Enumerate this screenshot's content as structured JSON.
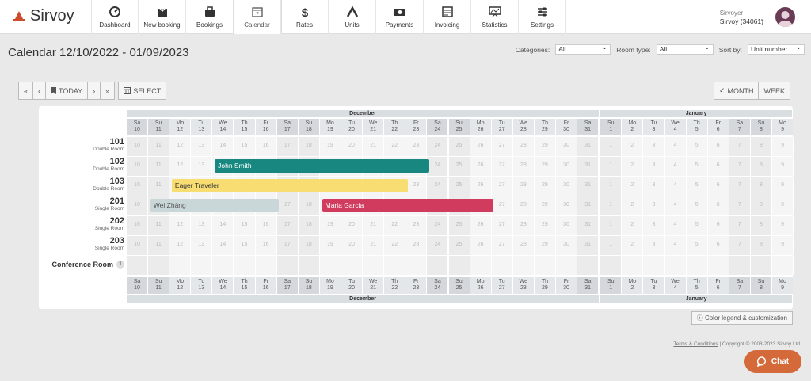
{
  "brand": {
    "name": "Sirvoy",
    "color": "#cc4b2b"
  },
  "nav": [
    {
      "label": "Dashboard",
      "icon": "dashboard-icon"
    },
    {
      "label": "New booking",
      "icon": "new-booking-icon"
    },
    {
      "label": "Bookings",
      "icon": "bookings-icon"
    },
    {
      "label": "Calendar",
      "icon": "calendar-icon",
      "active": true
    },
    {
      "label": "Rates",
      "icon": "dollar-icon"
    },
    {
      "label": "Units",
      "icon": "units-icon"
    },
    {
      "label": "Payments",
      "icon": "payments-icon"
    },
    {
      "label": "Invoicing",
      "icon": "invoicing-icon"
    },
    {
      "label": "Statistics",
      "icon": "statistics-icon"
    },
    {
      "label": "Settings",
      "icon": "settings-icon"
    }
  ],
  "user": {
    "name": "Sirvoyer",
    "account": "Sirvoy (34061)"
  },
  "page": {
    "title": "Calendar 12/10/2022 - 01/09/2023"
  },
  "filters": {
    "categories_label": "Categories:",
    "categories_value": "All",
    "roomtype_label": "Room type:",
    "roomtype_value": "All",
    "sortby_label": "Sort by:",
    "sortby_value": "Unit number"
  },
  "toolbar": {
    "first": "«",
    "prev": "‹",
    "today": "TODAY",
    "next": "›",
    "last": "»",
    "select": "SELECT",
    "month": "MONTH",
    "week": "WEEK"
  },
  "calendar": {
    "months": [
      {
        "name": "December"
      },
      {
        "name": "January"
      }
    ],
    "days": [
      {
        "dow": "Sa",
        "d": "10",
        "we": true
      },
      {
        "dow": "Su",
        "d": "11",
        "we": true
      },
      {
        "dow": "Mo",
        "d": "12"
      },
      {
        "dow": "Tu",
        "d": "13"
      },
      {
        "dow": "We",
        "d": "14"
      },
      {
        "dow": "Th",
        "d": "15"
      },
      {
        "dow": "Fr",
        "d": "16"
      },
      {
        "dow": "Sa",
        "d": "17",
        "we": true
      },
      {
        "dow": "Su",
        "d": "18",
        "we": true
      },
      {
        "dow": "Mo",
        "d": "19"
      },
      {
        "dow": "Tu",
        "d": "20"
      },
      {
        "dow": "We",
        "d": "21"
      },
      {
        "dow": "Th",
        "d": "22"
      },
      {
        "dow": "Fr",
        "d": "23"
      },
      {
        "dow": "Sa",
        "d": "24",
        "we": true
      },
      {
        "dow": "Su",
        "d": "25",
        "we": true
      },
      {
        "dow": "Mo",
        "d": "26"
      },
      {
        "dow": "Tu",
        "d": "27"
      },
      {
        "dow": "We",
        "d": "28"
      },
      {
        "dow": "Th",
        "d": "29"
      },
      {
        "dow": "Fr",
        "d": "30"
      },
      {
        "dow": "Sa",
        "d": "31",
        "we": true
      },
      {
        "dow": "Su",
        "d": "1",
        "we": true
      },
      {
        "dow": "Mo",
        "d": "2"
      },
      {
        "dow": "Tu",
        "d": "3"
      },
      {
        "dow": "We",
        "d": "4"
      },
      {
        "dow": "Th",
        "d": "5"
      },
      {
        "dow": "Fr",
        "d": "6"
      },
      {
        "dow": "Sa",
        "d": "7",
        "we": true
      },
      {
        "dow": "Su",
        "d": "8",
        "we": true
      },
      {
        "dow": "Mo",
        "d": "9"
      }
    ],
    "rooms": [
      {
        "number": "101",
        "type": "Double Room"
      },
      {
        "number": "102",
        "type": "Double Room"
      },
      {
        "number": "103",
        "type": "Double Room"
      },
      {
        "number": "201",
        "type": "Single Room"
      },
      {
        "number": "202",
        "type": "Single Room"
      },
      {
        "number": "203",
        "type": "Single Room"
      },
      {
        "number": "Conference Room",
        "type": "",
        "badge": "1"
      }
    ],
    "bookings": [
      {
        "guest": "John Smith",
        "room_index": 1,
        "start_day": "14",
        "end_day": "24",
        "color": "#17877f",
        "text_color": "#ffffff"
      },
      {
        "guest": "Eager Traveler",
        "room_index": 2,
        "start_day": "12",
        "end_day": "23",
        "color": "#f7dd72",
        "text_color": "#333333"
      },
      {
        "guest": "Wei Zhāng",
        "room_index": 3,
        "start_day": "11",
        "end_day": "17",
        "color": "#c9d7d9",
        "text_color": "#555555"
      },
      {
        "guest": "Maria Garcia",
        "room_index": 3,
        "start_day": "19",
        "end_day": "27",
        "color": "#d13b5e",
        "text_color": "#ffffff"
      }
    ]
  },
  "legend_button": "Color legend & customization",
  "footer": {
    "link": "Terms & Conditions",
    "text": " | Copyright © 2008-2023 Sirvoy Ltd"
  },
  "chat": {
    "label": "Chat"
  }
}
